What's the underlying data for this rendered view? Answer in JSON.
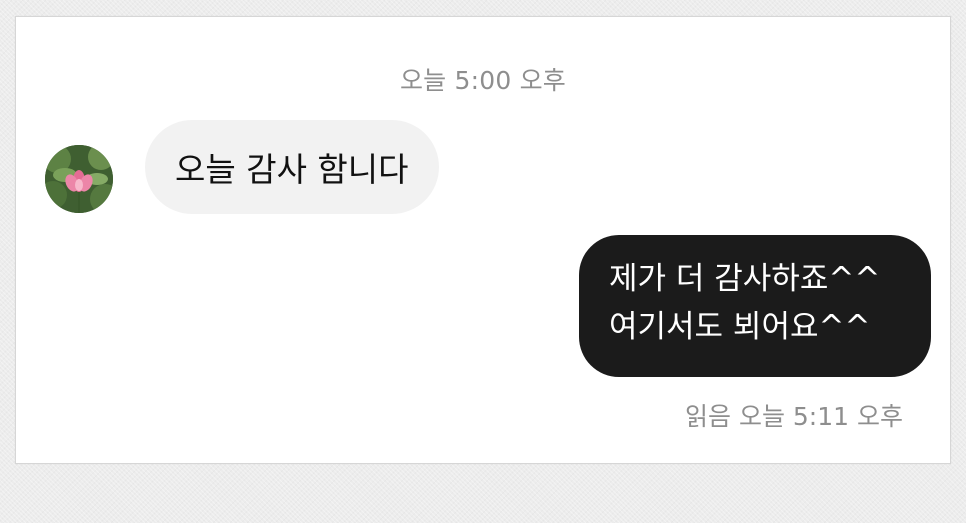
{
  "chat": {
    "top_timestamp": "오늘 5:00 오후",
    "incoming": {
      "text": "오늘 감사 함니다",
      "avatar_icon": "lotus-flower-profile-photo"
    },
    "outgoing": {
      "line1": "제가 더 감사하죠^^",
      "line2": "여기서도 뵈어요^^"
    },
    "status": {
      "read_label": "읽음",
      "time": "오늘 5:11 오후"
    }
  },
  "colors": {
    "incoming_bubble": "#f2f2f2",
    "outgoing_bubble": "#1b1b1b",
    "meta_text": "#8e8e8e"
  }
}
